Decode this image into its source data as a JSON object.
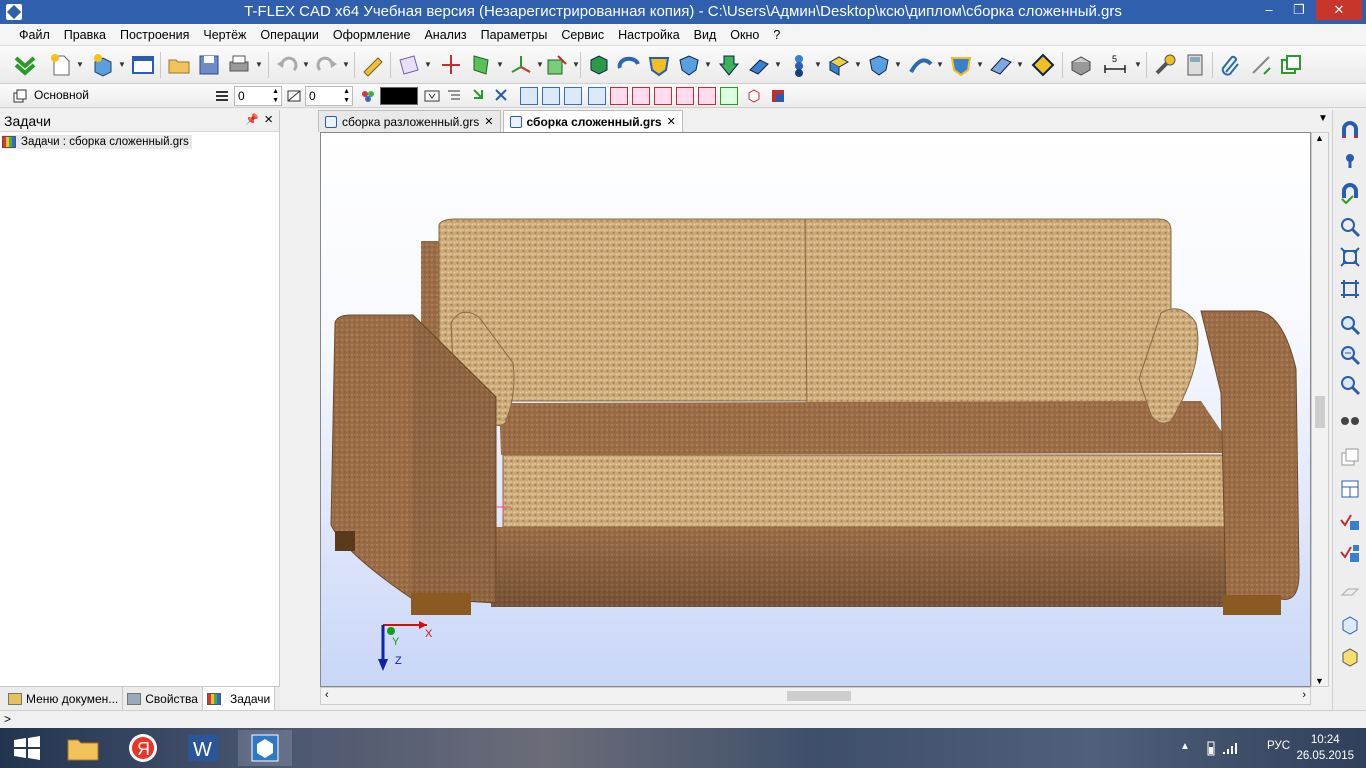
{
  "window": {
    "title": "T-FLEX CAD x64 Учебная версия (Незарегистрированная копия) - C:\\Users\\Админ\\Desktop\\ксю\\диплом\\сборка сложенный.grs",
    "min": "–",
    "max": "❐",
    "close": "✕"
  },
  "menu": [
    "Файл",
    "Правка",
    "Построения",
    "Чертёж",
    "Операции",
    "Оформление",
    "Анализ",
    "Параметры",
    "Сервис",
    "Настройка",
    "Вид",
    "Окно",
    "?"
  ],
  "toolbar2": {
    "layer_name": "Основной",
    "line_value_1": "0",
    "line_value_2": "0"
  },
  "left_panel": {
    "title": "Задачи",
    "pin": "📌",
    "close": "×",
    "tree_item": "Задачи : сборка сложенный.grs",
    "bottom_tabs": [
      "Меню докумен...",
      "Свойства",
      "Задачи"
    ]
  },
  "documents": {
    "tabs": [
      {
        "label": "сборка разложенный.grs",
        "active": false
      },
      {
        "label": "сборка сложенный.grs",
        "active": true
      }
    ],
    "tab_close": "✕",
    "tab_menu": "▼"
  },
  "viewport": {
    "axis_x": "X",
    "axis_y": "Y",
    "axis_z": "Z"
  },
  "statusbar": {
    "prompt": ">"
  },
  "taskbar": {
    "language": "РУС",
    "time": "10:24",
    "date": "26.05.2015"
  },
  "colors": {
    "titlebar": "#2f5fad",
    "close": "#c7352b",
    "fabric_light": "#c9a772",
    "fabric_dark": "#9a7048",
    "axis_x": "#d01010",
    "axis_y": "#10a010",
    "axis_z": "#1020b0"
  }
}
